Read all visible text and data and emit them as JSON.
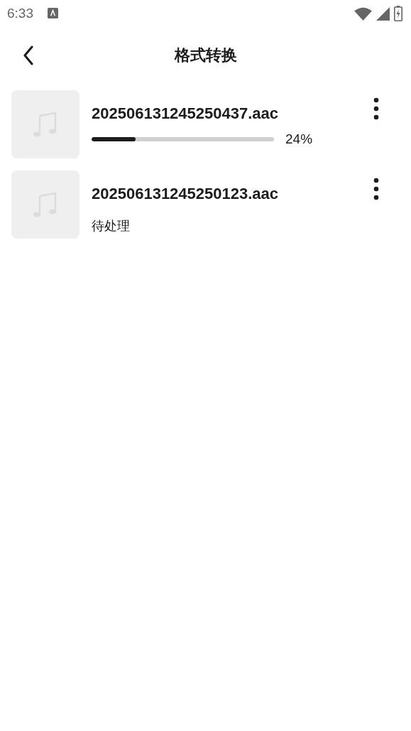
{
  "status_bar": {
    "time": "6:33"
  },
  "header": {
    "title": "格式转换"
  },
  "items": [
    {
      "kind": "progress",
      "name": "202506131245250437.aac",
      "level": 0.24,
      "reading": "24%"
    },
    {
      "kind": "pending",
      "name": "202506131245250123.aac",
      "status": "待处理"
    }
  ]
}
